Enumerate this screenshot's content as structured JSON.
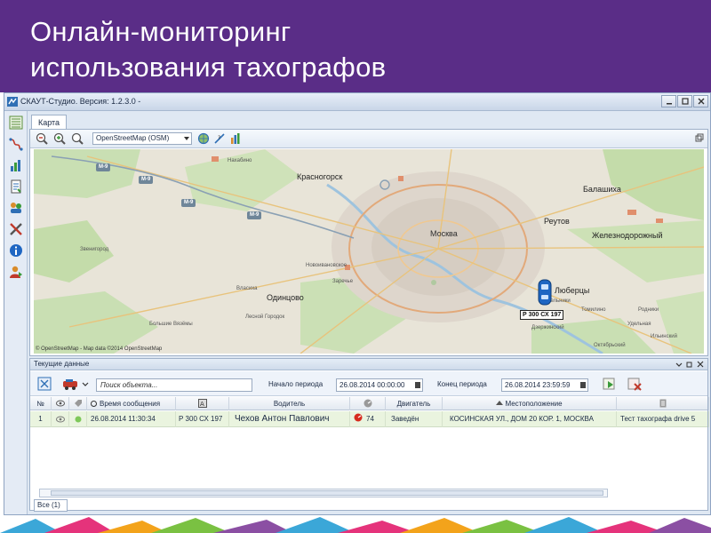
{
  "slide": {
    "title_line1": "Онлайн-мониторинг",
    "title_line2": "использования тахографов"
  },
  "colors": {
    "header_bg": "#5a2d87",
    "row_highlight": "#eaf4df",
    "window_chrome": "#dfe8f3"
  },
  "window": {
    "title": "СКАУТ-Студио. Версия: 1.2.3.0 -",
    "controls": [
      "minimize-icon",
      "maximize-icon",
      "close-icon"
    ]
  },
  "left_toolbar": {
    "icons": [
      "list-view-icon",
      "route-icon",
      "bar-chart-icon",
      "report-icon",
      "group-icon",
      "tools-icon",
      "info-icon",
      "user-icon"
    ]
  },
  "map": {
    "tab_label": "Карта",
    "source_select": "OpenStreetMap (OSM)",
    "copyright": "© OpenStreetMap - Map data ©2014 OpenStreetMap",
    "labels": {
      "nakhabino": "Нахабино",
      "krasnogorsk": "Красногорск",
      "balashikha": "Балашиха",
      "reutov": "Реутов",
      "zheleznodorozhny": "Железнодорожный",
      "moscow": "Москва",
      "zvenigorod": "Звенигород",
      "novoivanovskoe": "Новоивановское",
      "zarechye": "Заречье",
      "vlasikha": "Власиха",
      "odintsovo": "Одинцово",
      "lyubertsy": "Люберцы",
      "kotelniki": "Котельники",
      "tomilino": "Томилино",
      "rodniki": "Родники",
      "udelnaya": "Удельная",
      "ilinsky": "Ильинский",
      "oktyabrsky": "Октябрьский",
      "dzerzhinsky": "Дзержинский",
      "lesnoy_gorodok": "Лесной Городок",
      "bolshie_vyazemy": "Большие Вязёмы"
    },
    "road_shields": [
      "M-9",
      "M-9",
      "M-9",
      "M-9"
    ],
    "vehicle_label": "Р 300 СХ 197"
  },
  "data_panel": {
    "title": "Текущие данные",
    "search_placeholder": "Поиск объекта...",
    "period_start_label": "Начало периода",
    "period_start_value": "26.08.2014 00:00:00",
    "period_end_label": "Конец периода",
    "period_end_value": "26.08.2014 23:59:59",
    "columns": {
      "num": "№",
      "time": "Время сообщения",
      "driver": "Водитель",
      "engine": "Двигатель",
      "location": "Местоположение"
    },
    "row": {
      "num": "1",
      "time": "26.08.2014 11:30:34",
      "plate": "Р 300 СХ 197",
      "driver": "Чехов Антон Павлович",
      "speed": "74",
      "engine": "Заведён",
      "location": "КОСИНСКАЯ УЛ., ДОМ 20 КОР. 1, МОСКВА",
      "device": "Тест тахографа drive 5"
    },
    "footer_tab": "Все (1)"
  }
}
